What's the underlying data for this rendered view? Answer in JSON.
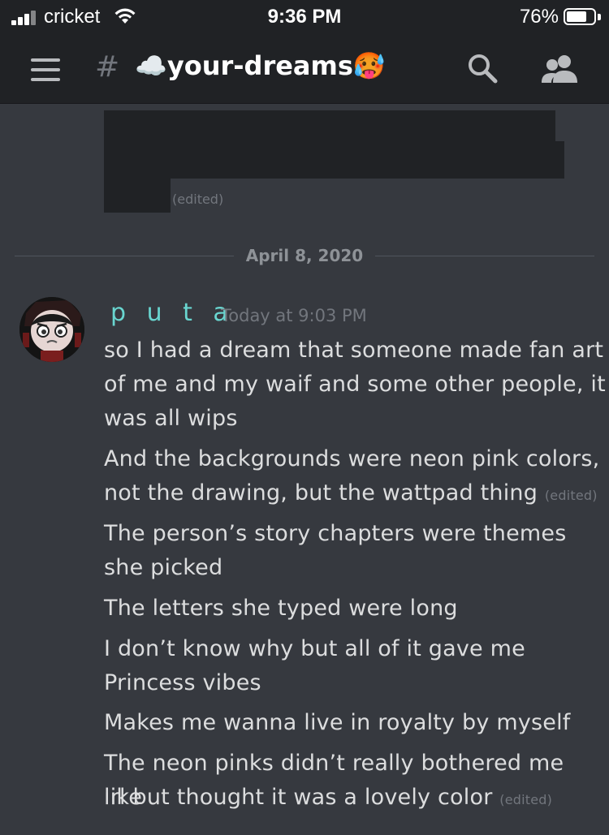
{
  "status_bar": {
    "carrier": "cricket",
    "time": "9:36 PM",
    "battery_percent": "76%",
    "battery_level": 0.76
  },
  "header": {
    "hash": "#",
    "channel_name": "☁️your-dreams🥵",
    "icons": [
      "hamburger-icon",
      "search-icon",
      "members-icon"
    ]
  },
  "previous_message": {
    "edited": "(edited)"
  },
  "divider": {
    "date": "April 8, 2020"
  },
  "message": {
    "username": "p u t a",
    "timestamp": "Today at 9:03 PM",
    "lines": [
      "so I had a dream that someone made fan art",
      "of me and my waif and some other people, it",
      "was all wips",
      "And the backgrounds were neon pink colors,",
      "not the drawing, but the wattpad thing",
      "The person’s story chapters were themes",
      "she picked",
      "The letters she typed were long",
      "I don’t know why but all of it gave me",
      "Princess vibes",
      "Makes me wanna live in royalty by myself",
      "The neon pinks didn’t really bothered me like",
      "irl but thought it was a lovely color"
    ],
    "edited_1": "(edited)",
    "edited_2": "(edited)"
  }
}
